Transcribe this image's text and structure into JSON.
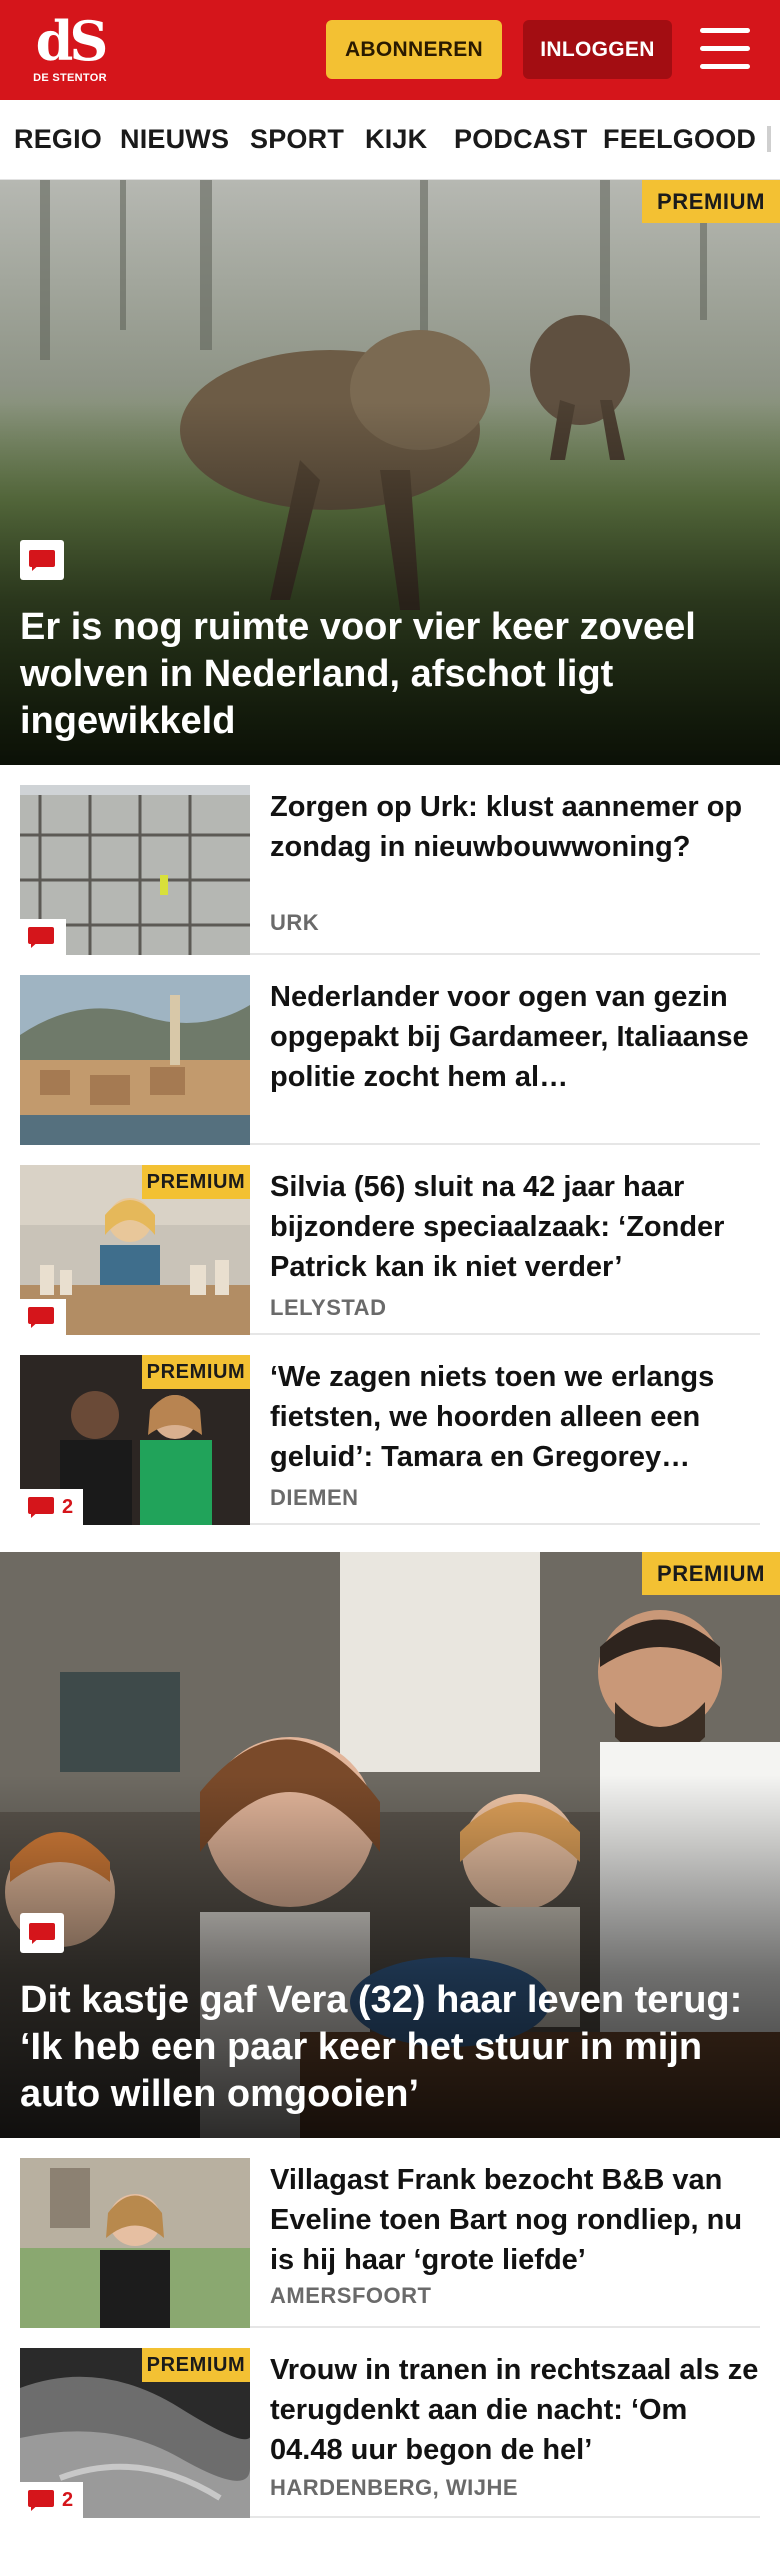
{
  "header": {
    "logo_mark": "dS",
    "logo_sub": "DE STENTOR",
    "subscribe_label": "ABONNEREN",
    "login_label": "INLOGGEN"
  },
  "nav": {
    "items": [
      "REGIO",
      "NIEUWS",
      "SPORT",
      "KIJK",
      "PODCAST",
      "FEELGOOD"
    ]
  },
  "premium_label": "PREMIUM",
  "hero1": {
    "title": "Er is nog ruimte voor vier keer zoveel wolven in Nederland, afschot ligt ingewikkeld",
    "premium": true,
    "has_comments": true
  },
  "teasers": [
    {
      "title": "Zorgen op Urk: klust aannemer op zondag in nieuwbouwwoning?",
      "location": "URK",
      "premium": false,
      "comments": ""
    },
    {
      "title": "Nederlander voor ogen van gezin opgepakt bij Gardameer, Italiaanse politie zocht hem al…",
      "location": "",
      "premium": false,
      "comments": null
    },
    {
      "title": "Silvia (56) sluit na 42 jaar haar bijzondere speciaalzaak: ‘Zonder Patrick kan ik niet verder’",
      "location": "LELYSTAD",
      "premium": true,
      "comments": ""
    },
    {
      "title": "‘We zagen niets toen we erlangs fietsten, we hoorden alleen een geluid’: Tamara en Gregorey…",
      "location": "DIEMEN",
      "premium": true,
      "comments": "2"
    }
  ],
  "hero2": {
    "title": "Dit kastje gaf Vera (32) haar leven terug: ‘Ik heb een paar keer het stuur in mijn auto willen omgooien’",
    "premium": true,
    "has_comments": true
  },
  "teasers2": [
    {
      "title": "Villagast Frank bezocht B&B van Eveline toen Bart nog rondliep, nu is hij haar ‘grote liefde’",
      "location": "AMERSFOORT",
      "premium": false,
      "comments": null
    },
    {
      "title": "Vrouw in tranen in rechtszaal als ze terugdenkt aan die nacht: ‘Om 04.48 uur begon de hel’",
      "location": "HARDENBERG, WIJHE",
      "premium": true,
      "comments": "2"
    }
  ],
  "colors": {
    "brand_red": "#d5151b",
    "premium_yellow": "#f3c133",
    "login_dark_red": "#a30d12"
  }
}
